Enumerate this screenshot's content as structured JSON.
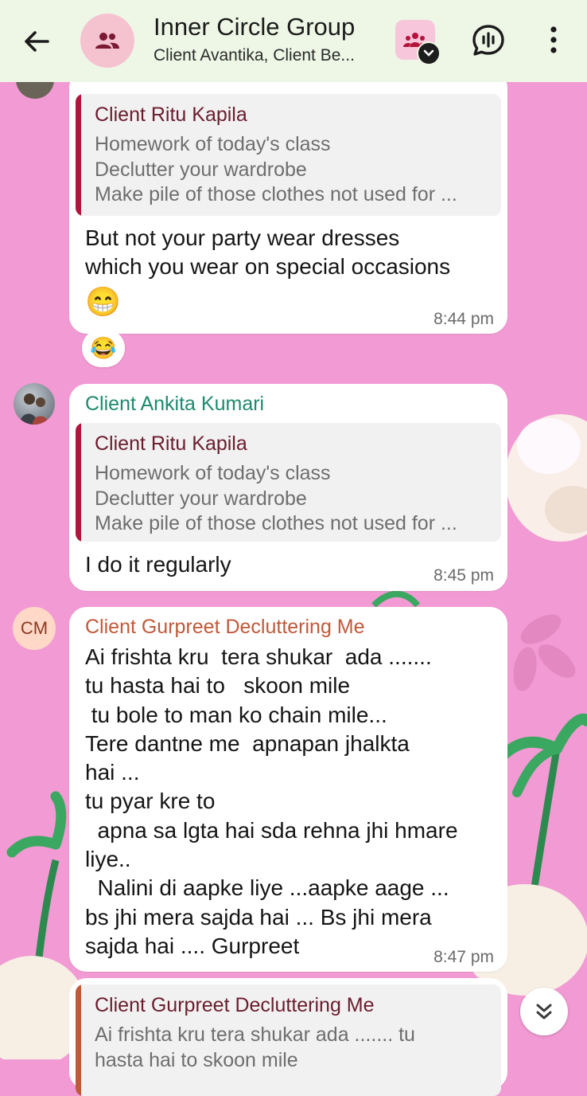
{
  "header": {
    "title": "Inner Circle Group",
    "subtitle": "Client Avantika, Client Be..."
  },
  "messages": [
    {
      "quote": {
        "author": "Client Ritu Kapila",
        "lines": [
          "Homework of today's class",
          "Declutter your wardrobe",
          "Make pile of those clothes not used for ..."
        ]
      },
      "text": "But not your party wear dresses\nwhich you wear on special occasions",
      "emoji": "😁",
      "time": "8:44 pm",
      "reaction": "😂"
    },
    {
      "sender": "Client Ankita Kumari",
      "quote": {
        "author": "Client Ritu Kapila",
        "lines": [
          "Homework of today's class",
          "Declutter your wardrobe",
          "Make pile of those clothes not used for ..."
        ]
      },
      "text": "I do it regularly",
      "time": "8:45 pm"
    },
    {
      "sender": "Client Gurpreet Decluttering Me",
      "avatar_initials": "CM",
      "text": "Ai frishta kru  tera shukar  ada .......\ntu hasta hai to   skoon mile\n tu bole to man ko chain mile...\nTere dantne me  apnapan jhalkta\nhai ...\ntu pyar kre to\n  apna sa lgta hai sda rehna jhi hmare\nliye..\n  Nalini di aapke liye ...aapke aage ...\nbs jhi mera sajda hai ... Bs jhi mera\nsajda hai .... Gurpreet",
      "time": "8:47 pm"
    },
    {
      "quote": {
        "author": "Client Gurpreet Decluttering Me",
        "lines": [
          "Ai frishta kru  tera shukar  ada .......  tu",
          "hasta hai to   skoon mile"
        ]
      }
    }
  ],
  "colors": {
    "header_bg": "#eef7e6",
    "chat_bg": "#f29ad3",
    "quote_author": "#6b1c2e",
    "quote_bar_ritu": "#b3143c",
    "quote_bar_gurpreet": "#c0593a",
    "sender_ankita": "#1e8a6e",
    "sender_gurpreet": "#c0593a"
  },
  "icons": [
    "back-arrow-icon",
    "group-icon",
    "community-icon",
    "chevron-down-icon",
    "voice-chat-icon",
    "more-vertical-icon",
    "double-chevron-down-icon"
  ]
}
